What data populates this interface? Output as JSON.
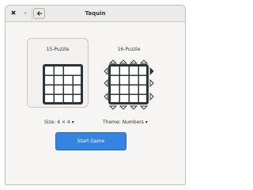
{
  "window": {
    "title": "Taquin",
    "close_glyph": "✖",
    "minimize_glyph": "–",
    "back_icon": "left-arrow-icon"
  },
  "options": {
    "puzzle_15": {
      "label": "15-Puzzle",
      "selected": true
    },
    "puzzle_16": {
      "label": "16-Puzzle",
      "selected": false
    }
  },
  "controls": {
    "size_label": "Size: 4 × 4 ▾",
    "theme_label": "Theme: Numbers ▾"
  },
  "actions": {
    "start_label": "Start Game"
  },
  "colors": {
    "accent": "#3584e4",
    "grid_frame": "#2e3436",
    "tile": "#ffffff"
  }
}
